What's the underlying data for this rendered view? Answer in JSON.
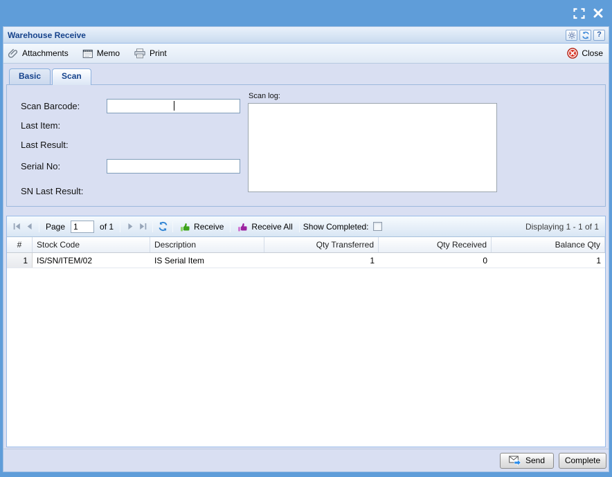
{
  "window": {
    "title": "Warehouse Receive"
  },
  "toolbar": {
    "attachments": "Attachments",
    "memo": "Memo",
    "print": "Print",
    "close": "Close"
  },
  "header_icons": {
    "help_glyph": "?"
  },
  "tabs": [
    {
      "label": "Basic",
      "active": false
    },
    {
      "label": "Scan",
      "active": true
    }
  ],
  "form": {
    "scan_barcode_label": "Scan Barcode:",
    "scan_barcode_value": "",
    "last_item_label": "Last Item:",
    "last_result_label": "Last Result:",
    "serial_no_label": "Serial No:",
    "serial_no_value": "",
    "sn_last_result_label": "SN Last Result:",
    "scan_log_label": "Scan log:",
    "scan_log_value": ""
  },
  "grid": {
    "paging": {
      "page_label": "Page",
      "page_value": "1",
      "of_label": "of 1"
    },
    "receive_label": "Receive",
    "receive_all_label": "Receive All",
    "show_completed_label": "Show Completed:",
    "show_completed_checked": false,
    "displaying": "Displaying 1 - 1 of 1",
    "columns": [
      "#",
      "Stock Code",
      "Description",
      "Qty Transferred",
      "Qty Received",
      "Balance Qty"
    ],
    "rows": [
      {
        "num": "1",
        "stock_code": "IS/SN/ITEM/02",
        "description": "IS Serial Item",
        "qty_transferred": "1",
        "qty_received": "0",
        "balance_qty": "1"
      }
    ]
  },
  "footer": {
    "send": "Send",
    "complete": "Complete"
  },
  "colors": {
    "frame_blue": "#5f9dd9",
    "title_text": "#15428b",
    "receive_green": "#3da21b",
    "receive_all_purple": "#9c23a0",
    "close_red": "#d93526",
    "panel_lavender": "#d9dff2"
  }
}
